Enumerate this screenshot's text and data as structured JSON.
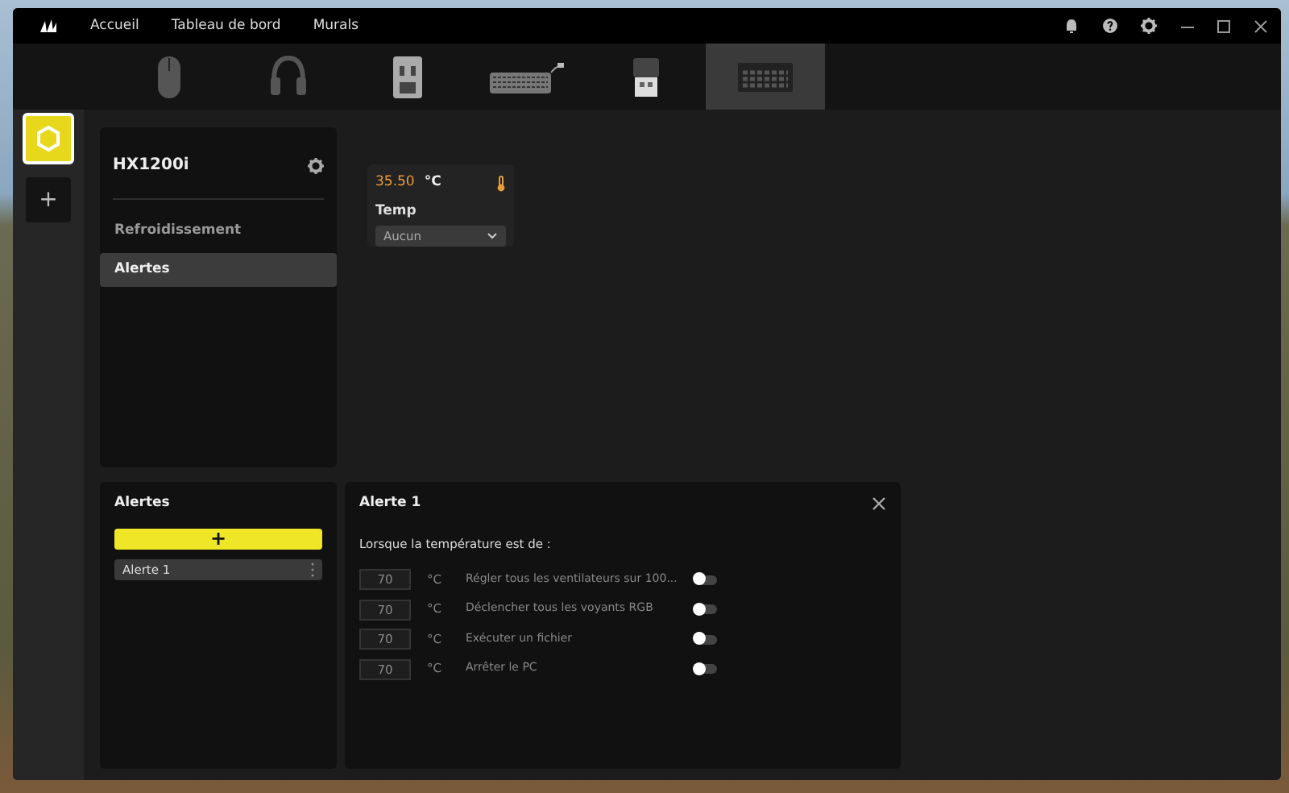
{
  "title_bar": {
    "nav": [
      {
        "label": "Accueil"
      },
      {
        "label": "Tableau de bord"
      },
      {
        "label": "Murals"
      }
    ]
  },
  "devices": [
    {
      "kind": "mouse",
      "selected": false
    },
    {
      "kind": "headset",
      "selected": false
    },
    {
      "kind": "hub",
      "selected": false
    },
    {
      "kind": "keyboard",
      "selected": false
    },
    {
      "kind": "dongle",
      "selected": false
    },
    {
      "kind": "psu",
      "selected": true
    }
  ],
  "device_rail": {
    "add": "+",
    "items": [
      {
        "selected": true
      }
    ]
  },
  "device_panel": {
    "name": "HX1200i",
    "menu": [
      {
        "label": "Refroidissement",
        "selected": false
      },
      {
        "label": "Alertes",
        "selected": true
      }
    ]
  },
  "sensor": {
    "value": "35.50",
    "unit": "°C",
    "label": "Temp",
    "dropdown": "Aucun"
  },
  "alerts_list": {
    "title": "Alertes",
    "add": "+",
    "items": [
      {
        "label": "Alerte 1",
        "selected": true
      }
    ]
  },
  "alert_detail": {
    "title": "Alerte 1",
    "prompt": "Lorsque la température est de :",
    "rules": [
      {
        "threshold": "70",
        "unit": "°C",
        "action": "Régler tous les ventilateurs sur 100...",
        "on": false
      },
      {
        "threshold": "70",
        "unit": "°C",
        "action": "Déclencher tous les voyants RGB",
        "on": false
      },
      {
        "threshold": "70",
        "unit": "°C",
        "action": "Exécuter un fichier",
        "on": false
      },
      {
        "threshold": "70",
        "unit": "°C",
        "action": "Arrêter le PC",
        "on": false
      }
    ]
  }
}
